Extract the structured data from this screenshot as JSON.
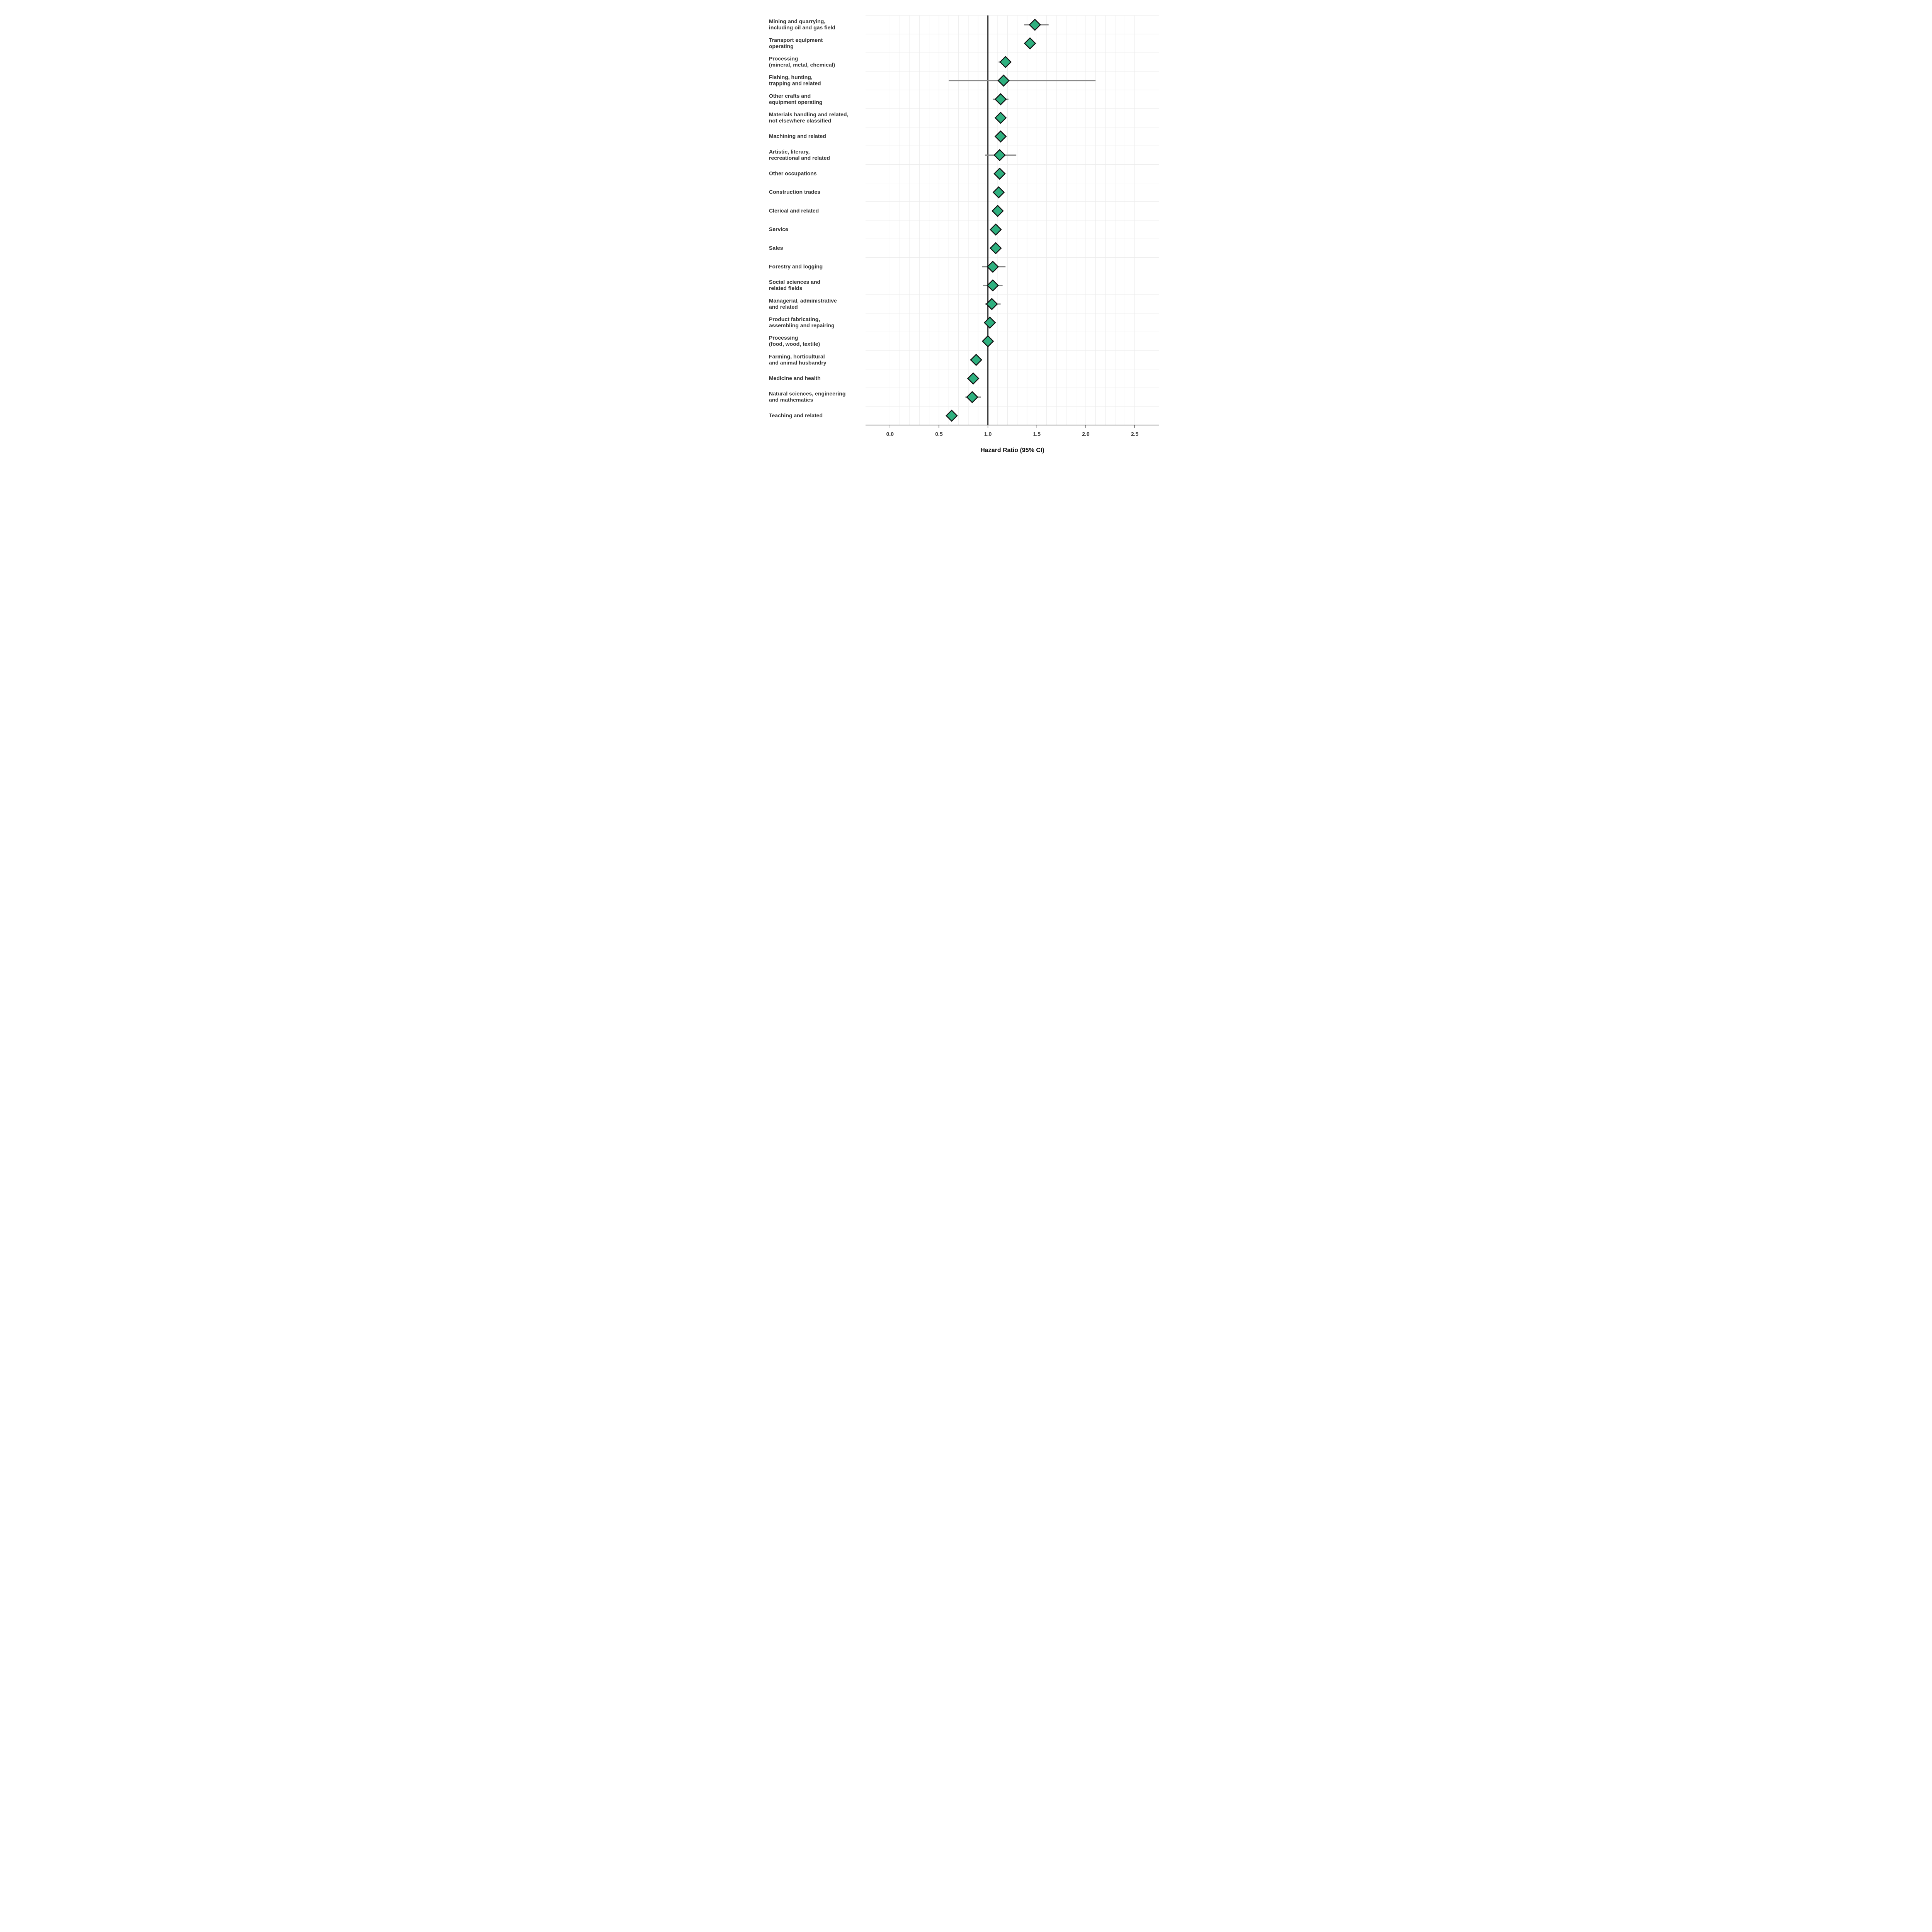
{
  "chart_data": {
    "type": "scatter",
    "title": "",
    "xlabel": "Hazard Ratio (95% CI)",
    "ylabel": "",
    "xlim": [
      -0.25,
      2.75
    ],
    "ref_line": 1.0,
    "xticks": [
      0.0,
      0.5,
      1.0,
      1.5,
      2.0,
      2.5
    ],
    "marker_fill": "#2fb07f",
    "marker_stroke": "#111111",
    "ci_color": "#888888",
    "grid_color": "#ebebeb",
    "bg": "#ffffff",
    "series": [
      {
        "label": "Mining and quarrying,\nincluding oil and gas field",
        "hr": 1.48,
        "lo": 1.37,
        "hi": 1.62
      },
      {
        "label": "Transport equipment\noperating",
        "hr": 1.43,
        "lo": 1.38,
        "hi": 1.47
      },
      {
        "label": "Processing\n(mineral, metal, chemical)",
        "hr": 1.18,
        "lo": 1.11,
        "hi": 1.22
      },
      {
        "label": "Fishing, hunting,\ntrapping and related",
        "hr": 1.16,
        "lo": 0.6,
        "hi": 2.1
      },
      {
        "label": "Other crafts and\nequipment operating",
        "hr": 1.13,
        "lo": 1.05,
        "hi": 1.21
      },
      {
        "label": "Materials handling and related,\nnot elsewhere classified",
        "hr": 1.13,
        "lo": 1.08,
        "hi": 1.18
      },
      {
        "label": "Machining and related",
        "hr": 1.13,
        "lo": 1.07,
        "hi": 1.17
      },
      {
        "label": "Artistic, literary,\nrecreational and related",
        "hr": 1.12,
        "lo": 0.97,
        "hi": 1.29
      },
      {
        "label": "Other occupations",
        "hr": 1.12,
        "lo": 1.07,
        "hi": 1.17
      },
      {
        "label": "Construction trades",
        "hr": 1.11,
        "lo": 1.07,
        "hi": 1.15
      },
      {
        "label": "Clerical and related",
        "hr": 1.1,
        "lo": 1.05,
        "hi": 1.14
      },
      {
        "label": "Service",
        "hr": 1.08,
        "lo": 1.03,
        "hi": 1.12
      },
      {
        "label": "Sales",
        "hr": 1.08,
        "lo": 1.02,
        "hi": 1.13
      },
      {
        "label": "Forestry and logging",
        "hr": 1.05,
        "lo": 0.94,
        "hi": 1.18
      },
      {
        "label": "Social sciences and\nrelated fields",
        "hr": 1.05,
        "lo": 0.95,
        "hi": 1.15
      },
      {
        "label": "Managerial, administrative\nand related",
        "hr": 1.04,
        "lo": 0.97,
        "hi": 1.13
      },
      {
        "label": "Product fabricating,\nassembling and repairing",
        "hr": 1.02,
        "lo": 0.98,
        "hi": 1.06
      },
      {
        "label": "Processing\n(food, wood, textile)",
        "hr": 1.0,
        "lo": 0.95,
        "hi": 1.05
      },
      {
        "label": "Farming, horticultural\nand animal husbandry",
        "hr": 0.88,
        "lo": 0.82,
        "hi": 0.94
      },
      {
        "label": "Medicine and health",
        "hr": 0.85,
        "lo": 0.8,
        "hi": 0.9
      },
      {
        "label": "Natural sciences, engineering\nand mathematics",
        "hr": 0.84,
        "lo": 0.77,
        "hi": 0.93
      },
      {
        "label": "Teaching and related",
        "hr": 0.63,
        "lo": 0.58,
        "hi": 0.68
      }
    ]
  }
}
